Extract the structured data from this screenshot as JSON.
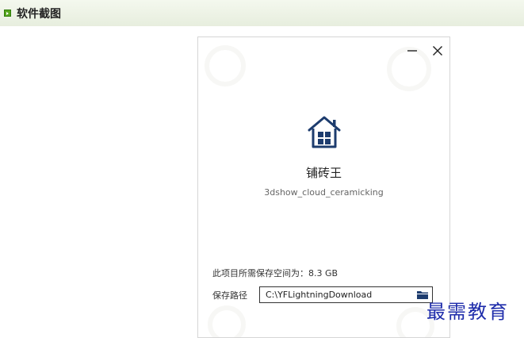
{
  "section": {
    "title": "软件截图"
  },
  "dialog": {
    "app_name": "铺砖王",
    "app_id": "3dshow_cloud_ceramicking",
    "space_info": "此项目所需保存空间为：8.3 GB",
    "path_label": "保存路径",
    "path_value": "C:\\YFLightningDownload",
    "icons": {
      "minimize": "minimize-icon",
      "close": "close-icon",
      "app": "house-icon",
      "folder": "folder-icon"
    },
    "colors": {
      "app_icon": "#1d3c6e",
      "accent_green": "#55a51c"
    }
  },
  "watermark": {
    "text": "最需教育"
  }
}
